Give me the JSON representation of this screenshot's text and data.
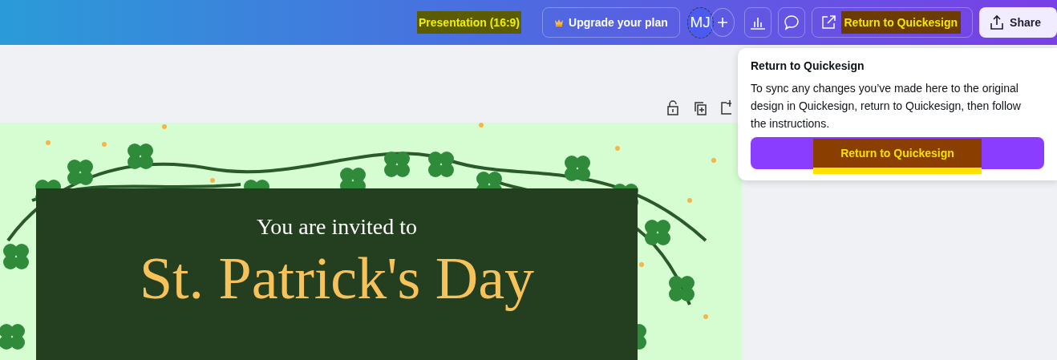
{
  "header": {
    "title": {
      "text": "Presentation (16:9)",
      "highlighted": true
    },
    "upgrade_button": "Upgrade your plan",
    "avatar": "MJ",
    "return_button": {
      "label": "Return to Quickesign",
      "highlighted": true
    },
    "share_button": "Share"
  },
  "design": {
    "subtitle": "You are invited to",
    "title": "St. Patrick's Day"
  },
  "popover": {
    "title": "Return to Quickesign",
    "body": "To sync any changes you’ve made here to the original design in Quickesign, return to Quickesign, then follow the instructions.",
    "button": {
      "label": "Return to Quickesign",
      "highlighted": true
    }
  }
}
